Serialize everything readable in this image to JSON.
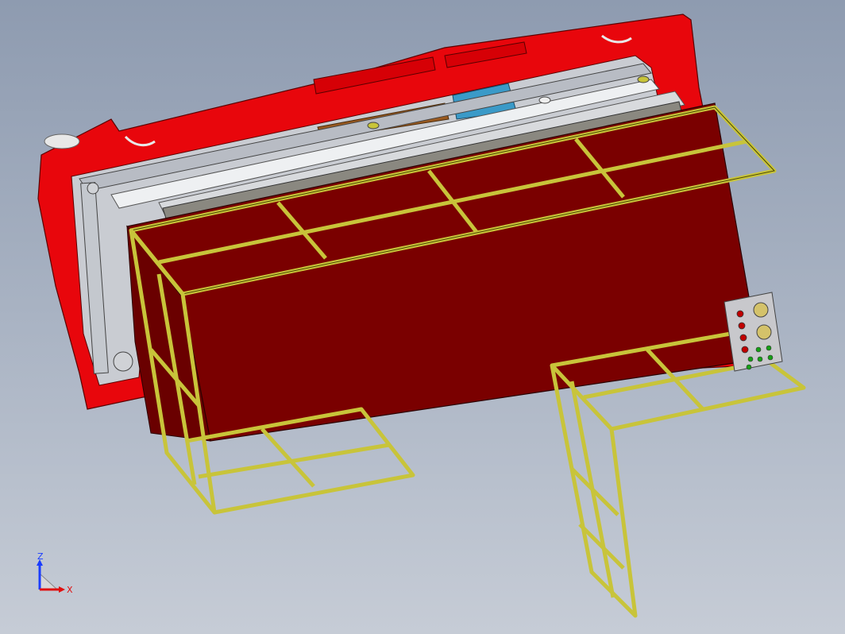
{
  "viewport": {
    "background_top": "#8e9bb0",
    "background_bottom": "#c6ccd6",
    "model_colors": {
      "housing_red": "#e8060c",
      "panel_darkred": "#7a0000",
      "frame_yellow": "#c8c43a",
      "frame_outline": "#4a4600",
      "steel_grey": "#b8bcc4",
      "steel_white": "#eef0f2",
      "bar_grey": "#8a8880",
      "blue_part": "#3a9ac8",
      "brown_part": "#9a5a20",
      "control_box": "#c8c8cc"
    },
    "control_panel": {
      "red_lamps": 4,
      "green_lamps": 6
    }
  },
  "triad": {
    "z_label": "Z",
    "x_label": "X",
    "z_color": "#1a3cff",
    "x_color": "#e01010"
  }
}
